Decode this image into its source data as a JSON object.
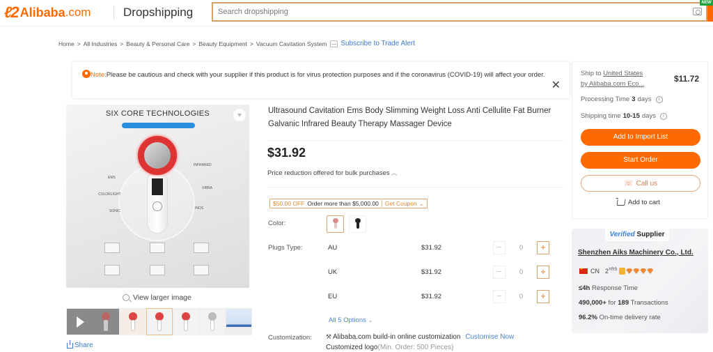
{
  "header": {
    "logo_mark": "ℓℤ",
    "logo_text": "Alibaba",
    "logo_domain": ".com",
    "app_name": "Dropshipping",
    "search_placeholder": "Search dropshipping",
    "new_badge": "NEW",
    "camera_icon": "camera-icon"
  },
  "breadcrumb": {
    "items": [
      "Home",
      "All Industries",
      "Beauty & Personal Care",
      "Beauty Equipment",
      "Vacuum Cavitation System"
    ],
    "separator": ">",
    "subscribe": "Subscribe to Trade Alert"
  },
  "note": {
    "label": "Note:",
    "text": "Please be cautious and check with your supplier if this product is for virus protection purposes and if the coronavirus (COVID-19) will affect your order.",
    "close": "✕"
  },
  "gallery": {
    "image_title": "SIX CORE TECHNOLOGIES",
    "image_labels": [
      "EMS",
      "COLORLIGHT",
      "SONIC",
      "INFRARED",
      "VIBRA",
      "INOS"
    ],
    "view_larger": "View larger image",
    "share": "Share",
    "thumbnail_count": 6
  },
  "product": {
    "title": "Ultrasound Cavitation Ems Body Slimming Weight Loss Anti Cellulite Fat Burner Galvanic Infrared Beauty Therapy Massager Device",
    "price": "$31.92",
    "bulk_note": "Price reduction offered for bulk purchases",
    "coupon": {
      "off": "$50.00 OFF",
      "condition": "Order more than $5,000.00",
      "action": "Get Coupon"
    },
    "color_label": "Color:",
    "colors": [
      {
        "name": "pink",
        "selected": true,
        "color": "#d98a8a"
      },
      {
        "name": "black",
        "selected": false,
        "color": "#222222"
      }
    ],
    "plugs_label": "Plugs Type:",
    "plugs": [
      {
        "name": "AU",
        "price": "$31.92",
        "qty": "0"
      },
      {
        "name": "UK",
        "price": "$31.92",
        "qty": "0"
      },
      {
        "name": "EU",
        "price": "$31.92",
        "qty": "0"
      }
    ],
    "stepper_minus": "−",
    "stepper_plus": "+",
    "all_options": "All 5 Options",
    "customization_label": "Customization:",
    "customization_text": "Alibaba.com build-in online customization",
    "customise_now": "Customise Now",
    "custom_logo": "Customized logo",
    "custom_logo_min": "(Min. Order: 500 Pieces)"
  },
  "shipping": {
    "ship_to_prefix": "Ship to ",
    "ship_to_country": "United States",
    "ship_by": "by Alibaba.com Eco...",
    "ship_price": "$11.72",
    "processing_label": "Processing Time",
    "processing_value": "3",
    "processing_unit": "days",
    "shipping_label": "Shipping time",
    "shipping_value": "10-15",
    "shipping_unit": "days",
    "add_import": "Add to Import List",
    "start_order": "Start Order",
    "call_us": "Call us",
    "add_cart": "Add to cart"
  },
  "supplier": {
    "verified_prefix": "Verified",
    "verified_suffix": " Supplier",
    "name": "Shenzhen Aiks Machinery Co., Ltd.",
    "country": "CN",
    "years": "2",
    "years_unit": "YRS",
    "response_value": "≤4h",
    "response_label": " Response Time",
    "transactions_amount": "490,000+",
    "transactions_mid": " for ",
    "transactions_count": "189",
    "transactions_label": " Transactions",
    "delivery_value": "96.2%",
    "delivery_label": " On-time delivery rate"
  },
  "colors": {
    "brand_orange": "#ff6a00",
    "link_blue": "#3d78c9"
  }
}
